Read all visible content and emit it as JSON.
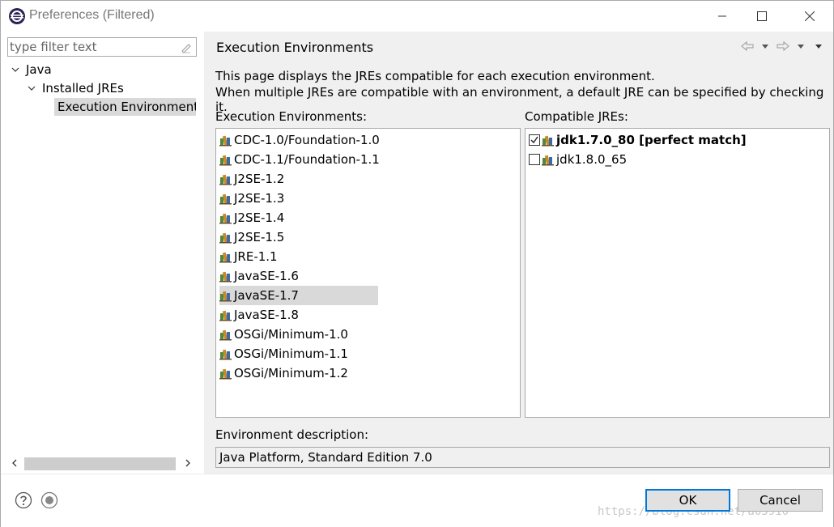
{
  "window": {
    "title": "Preferences (Filtered)"
  },
  "filter": {
    "placeholder": "type filter text"
  },
  "tree": [
    {
      "label": "Java",
      "level": 0,
      "expanded": true
    },
    {
      "label": "Installed JREs",
      "level": 1,
      "expanded": true
    },
    {
      "label": "Execution Environments",
      "level": 2,
      "selected": true
    }
  ],
  "page": {
    "title": "Execution Environments",
    "description_line1": "This page displays the JREs compatible for each execution environment.",
    "description_line2": "When multiple JREs are compatible with an environment, a default JRE can be specified by checking it.",
    "env_label": "Execution Environments:",
    "jre_label": "Compatible JREs:",
    "env_desc_label": "Environment description:",
    "env_desc_value": "Java Platform, Standard Edition 7.0"
  },
  "environments": [
    "CDC-1.0/Foundation-1.0",
    "CDC-1.1/Foundation-1.1",
    "J2SE-1.2",
    "J2SE-1.3",
    "J2SE-1.4",
    "J2SE-1.5",
    "JRE-1.1",
    "JavaSE-1.6",
    "JavaSE-1.7",
    "JavaSE-1.8",
    "OSGi/Minimum-1.0",
    "OSGi/Minimum-1.1",
    "OSGi/Minimum-1.2"
  ],
  "selected_environment": "JavaSE-1.7",
  "jres": [
    {
      "label": "jdk1.7.0_80 [perfect match]",
      "checked": true,
      "bold": true
    },
    {
      "label": "jdk1.8.0_65",
      "checked": false,
      "bold": false
    }
  ],
  "buttons": {
    "ok": "OK",
    "cancel": "Cancel"
  },
  "watermark": "https://blog.csdn.net/a05910",
  "colors": {
    "accent": "#0078d7",
    "panel_bg": "#f0f0f0",
    "selection_bg": "#d9d9d9"
  }
}
